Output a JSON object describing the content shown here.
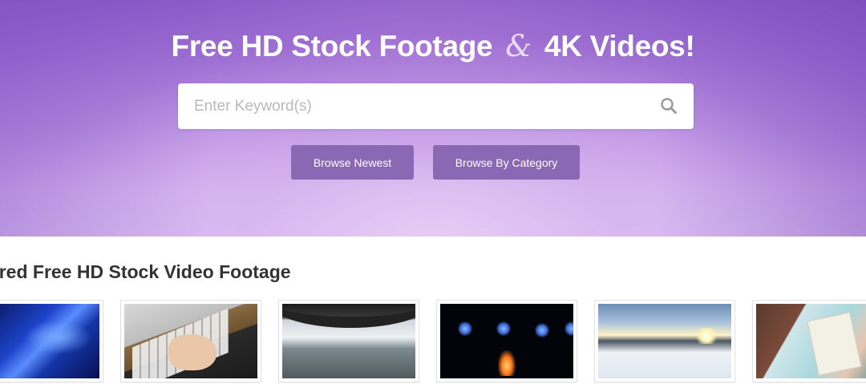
{
  "hero": {
    "title_part1": "Free HD Stock Footage",
    "title_amp": "&",
    "title_part2": "4K Videos!",
    "colors": {
      "gradient_top": "#8a5cc7",
      "gradient_bottom": "#dcbef2",
      "button": "#8a68b4"
    }
  },
  "search": {
    "placeholder": "Enter Keyword(s)",
    "value": "",
    "icon": "search-icon"
  },
  "buttons": {
    "browse_newest": "Browse Newest",
    "browse_category": "Browse By Category"
  },
  "featured": {
    "title": "tured Free HD Stock Video Footage",
    "thumbnails": [
      {
        "name": "blue-abstract-thumbnail"
      },
      {
        "name": "laptop-typing-thumbnail"
      },
      {
        "name": "bridge-river-thumbnail"
      },
      {
        "name": "night-fire-thumbnail"
      },
      {
        "name": "snow-sunset-thumbnail"
      },
      {
        "name": "painting-card-thumbnail"
      }
    ]
  }
}
